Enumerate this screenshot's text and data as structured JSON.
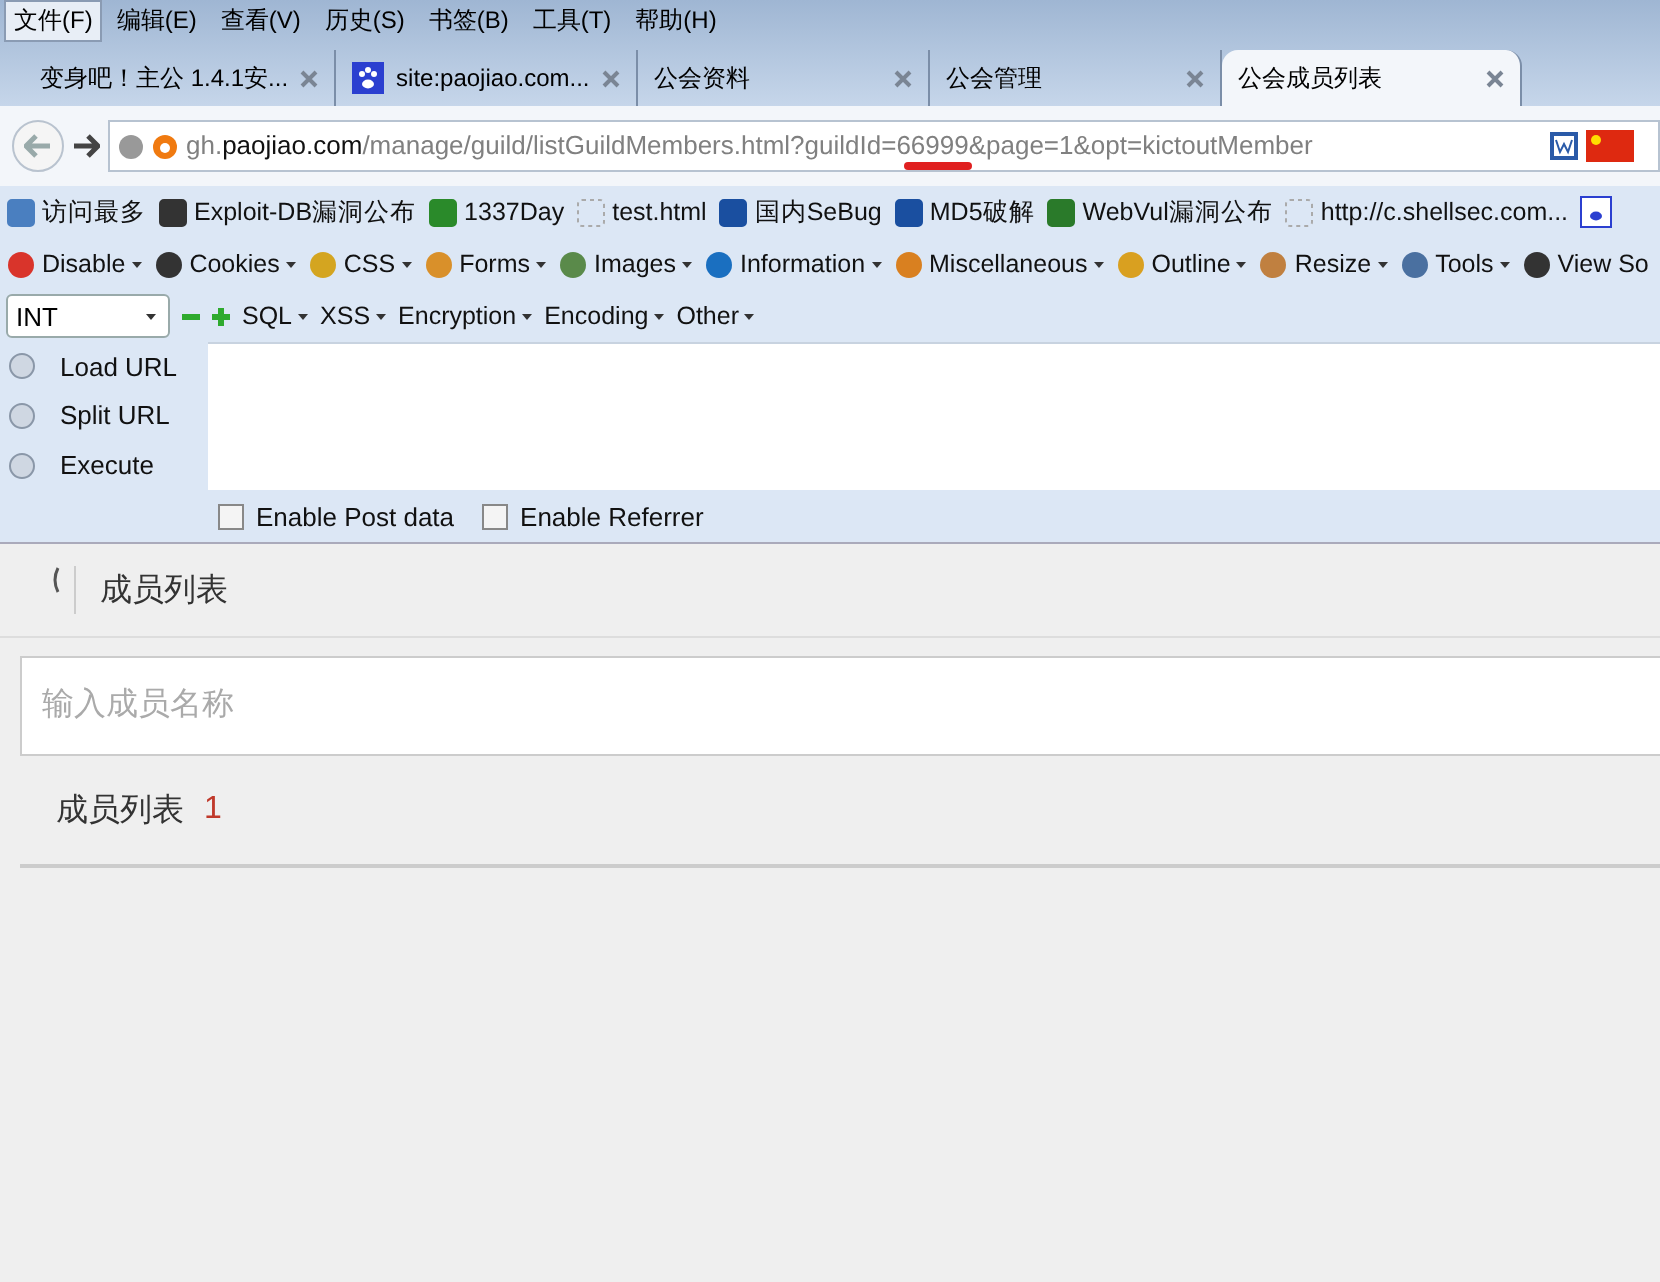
{
  "menu": [
    {
      "label": "文件(F)",
      "selected": true
    },
    {
      "label": "编辑(E)",
      "selected": false
    },
    {
      "label": "查看(V)",
      "selected": false
    },
    {
      "label": "历史(S)",
      "selected": false
    },
    {
      "label": "书签(B)",
      "selected": false
    },
    {
      "label": "工具(T)",
      "selected": false
    },
    {
      "label": "帮助(H)",
      "selected": false
    }
  ],
  "tabs": [
    {
      "title": "变身吧！主公 1.4.1安...",
      "selected": false,
      "has_icon": false
    },
    {
      "title": "site:paojiao.com...",
      "selected": false,
      "has_icon": true
    },
    {
      "title": "公会资料",
      "selected": false,
      "has_icon": false
    },
    {
      "title": "公会管理",
      "selected": false,
      "has_icon": false
    },
    {
      "title": "公会成员列表",
      "selected": true,
      "has_icon": false
    }
  ],
  "address": {
    "parts": [
      {
        "text": "gh.",
        "kind": "plain"
      },
      {
        "text": "paojiao.com",
        "kind": "domain"
      },
      {
        "text": "/manage/guild/listGuildMembers.html?guildId=",
        "kind": "plain"
      },
      {
        "text": "66999",
        "kind": "marked"
      },
      {
        "text": "&page=1&opt=kictoutMember",
        "kind": "plain"
      }
    ]
  },
  "bookmarks": [
    {
      "label": "访问最多"
    },
    {
      "label": "Exploit-DB漏洞公布"
    },
    {
      "label": "1337Day"
    },
    {
      "label": "test.html"
    },
    {
      "label": "国内SeBug"
    },
    {
      "label": "MD5破解"
    },
    {
      "label": "WebVul漏洞公布"
    },
    {
      "label": "http://c.shellsec.com..."
    }
  ],
  "hackbar_menu": [
    {
      "label": "Disable"
    },
    {
      "label": "Cookies"
    },
    {
      "label": "CSS"
    },
    {
      "label": "Forms"
    },
    {
      "label": "Images"
    },
    {
      "label": "Information"
    },
    {
      "label": "Miscellaneous"
    },
    {
      "label": "Outline"
    },
    {
      "label": "Resize"
    },
    {
      "label": "Tools"
    },
    {
      "label": "View So"
    }
  ],
  "hackbar": {
    "type_select": "INT",
    "menus": [
      {
        "label": "SQL"
      },
      {
        "label": "XSS"
      },
      {
        "label": "Encryption"
      },
      {
        "label": "Encoding"
      },
      {
        "label": "Other"
      }
    ],
    "actions": [
      {
        "label": "Load URL"
      },
      {
        "label": "Split URL"
      },
      {
        "label": "Execute"
      }
    ],
    "options": [
      {
        "label": "Enable Post data",
        "checked": false
      },
      {
        "label": "Enable Referrer",
        "checked": false
      }
    ]
  },
  "page": {
    "heading": "成员列表",
    "search": {
      "placeholder": "输入成员名称"
    },
    "list_title": "成员列表",
    "count": "1"
  }
}
